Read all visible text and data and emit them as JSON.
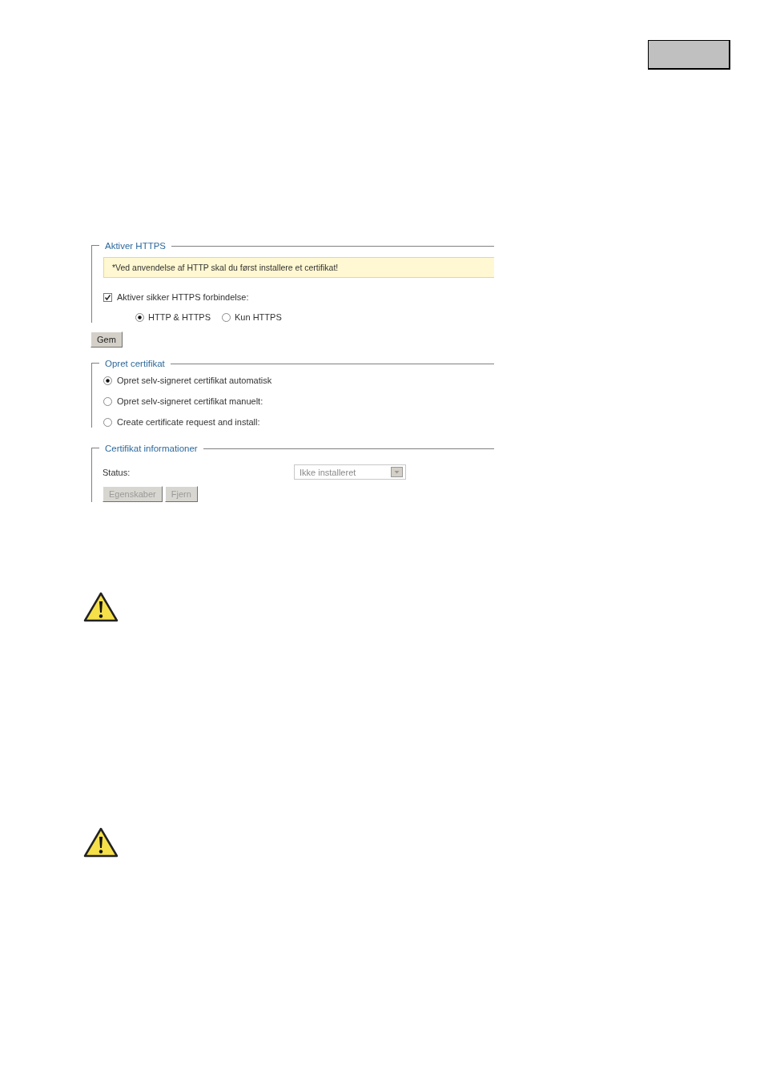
{
  "sections": [
    {
      "title": "Aktiver HTTPS",
      "notice": "*Ved anvendelse af HTTP skal du først installere et certifikat!",
      "items": [
        {
          "kind": "checkbox",
          "label": "Aktiver sikker HTTPS forbindelse:",
          "checked": true
        },
        {
          "kind": "radio_row",
          "options": [
            {
              "label": "HTTP & HTTPS",
              "selected": true
            },
            {
              "label": "Kun HTTPS",
              "selected": false
            }
          ]
        }
      ],
      "after_button": {
        "label": "Gem",
        "disabled": false
      }
    },
    {
      "title": "Opret certifikat",
      "items": [
        {
          "kind": "radio",
          "label": "Opret selv-signeret certifikat automatisk",
          "selected": true
        },
        {
          "kind": "radio",
          "label": "Opret selv-signeret certifikat manuelt:",
          "selected": false
        },
        {
          "kind": "radio",
          "label": "Create certificate request and install:",
          "selected": false
        }
      ]
    },
    {
      "title": "Certifikat informationer",
      "items": [
        {
          "kind": "field",
          "label": "Status:",
          "value": "Ikke installeret",
          "disabled": true
        },
        {
          "kind": "buttons",
          "buttons": [
            {
              "label": "Egenskaber",
              "disabled": true
            },
            {
              "label": "Fjern",
              "disabled": true
            }
          ]
        }
      ]
    }
  ],
  "warnings": [
    {
      "kind": "warning"
    },
    {
      "kind": "warning"
    }
  ]
}
